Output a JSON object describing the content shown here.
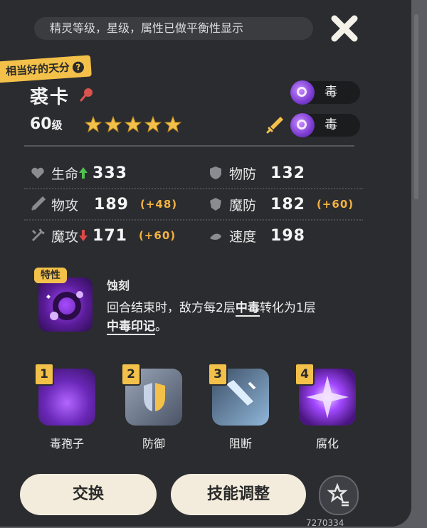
{
  "banner": "精灵等级，星级，属性已做平衡性显示",
  "talent_badge": "相当好的天分",
  "talent_help": "?",
  "pet": {
    "name": "裘卡",
    "level_number": "60",
    "level_unit": "级",
    "stars": 5,
    "attribute_primary": "毒",
    "attribute_secondary": "毒"
  },
  "stats": [
    {
      "label": "生命",
      "value": "333",
      "bonus": "",
      "arrow": "up"
    },
    {
      "label": "物防",
      "value": "132",
      "bonus": ""
    },
    {
      "label": "物攻",
      "value": "189",
      "bonus": "(+48)"
    },
    {
      "label": "魔防",
      "value": "182",
      "bonus": "(+60)"
    },
    {
      "label": "魔攻",
      "value": "171",
      "bonus": "(+60)",
      "arrow": "down"
    },
    {
      "label": "速度",
      "value": "198",
      "bonus": ""
    }
  ],
  "trait": {
    "badge": "特性",
    "name": "蚀刻",
    "desc_1": "回合结束时，敌方每2层",
    "desc_keyword_1": "中毒",
    "desc_2": "转化为1层",
    "desc_keyword_2": "中毒印记",
    "desc_3": "。"
  },
  "skills": [
    {
      "num": "1",
      "name": "毒孢子"
    },
    {
      "num": "2",
      "name": "防御"
    },
    {
      "num": "3",
      "name": "阻断"
    },
    {
      "num": "4",
      "name": "腐化"
    }
  ],
  "buttons": {
    "swap": "交换",
    "skill_adjust": "技能调整"
  },
  "watermark": "7270334",
  "colors": {
    "accent": "#f3c14a",
    "poison": "#8b45e0",
    "bonus": "#f3b342",
    "button": "#f3ecdc"
  }
}
